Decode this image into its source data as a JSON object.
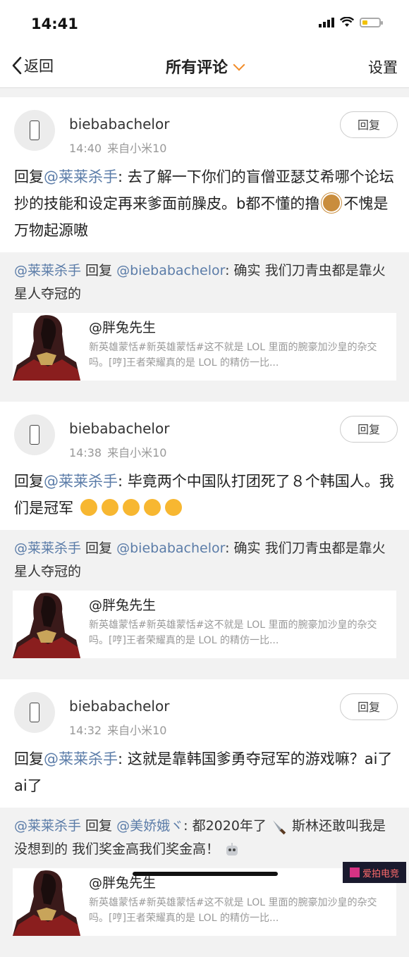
{
  "status_bar": {
    "time": "14:41"
  },
  "nav": {
    "back_label": "返回",
    "title": "所有评论",
    "settings_label": "设置"
  },
  "cards": [
    {
      "username": "biebabachelor",
      "time": "14:40",
      "source": "来自小米10",
      "reply_button": "回复",
      "comment_prefix": "回复",
      "comment_mention": "@莱莱杀手",
      "comment_text": ": 去了解一下你们的盲僧亚瑟艾希哪个论坛抄的技能和设定再来爹面前臊皮。b都不懂的撸",
      "comment_tail": "不愧是万物起源嗷",
      "quote_mention": "@莱莱杀手",
      "quote_reply": " 回复 ",
      "quote_target": "@biebabachelor",
      "quote_text": ": 确实 我们刀青虫都是靠火星人夺冠的",
      "embed_title": "@胖兔先生",
      "embed_desc": "新英雄蒙恬#新英雄蒙恬#这不就是 LOL 里面的腕豪加沙皇的杂交吗。[哼]王者荣耀真的是 LOL 的精仿一比..."
    },
    {
      "username": "biebabachelor",
      "time": "14:38",
      "source": "来自小米10",
      "reply_button": "回复",
      "comment_prefix": "回复",
      "comment_mention": "@莱莱杀手",
      "comment_text": ": 毕竟两个中国队打团死了８个韩国人。我们是冠军",
      "comment_tail": "",
      "quote_mention": "@莱莱杀手",
      "quote_reply": " 回复 ",
      "quote_target": "@biebabachelor",
      "quote_text": ": 确实 我们刀青虫都是靠火星人夺冠的",
      "embed_title": "@胖兔先生",
      "embed_desc": "新英雄蒙恬#新英雄蒙恬#这不就是 LOL 里面的腕豪加沙皇的杂交吗。[哼]王者荣耀真的是 LOL 的精仿一比..."
    },
    {
      "username": "biebabachelor",
      "time": "14:32",
      "source": "来自小米10",
      "reply_button": "回复",
      "comment_prefix": "回复",
      "comment_mention": "@莱莱杀手",
      "comment_text": ": 这就是靠韩国爹勇夺冠军的游戏嘛？ai了ai了",
      "comment_tail": "",
      "quote_mention": "@莱莱杀手",
      "quote_reply": " 回复 ",
      "quote_target": "@美娇娥ヾ",
      "quote_text": ": 都2020年了",
      "quote_text2": "斯林还敢叫我是没想到的 我们奖金高我们奖金高！",
      "embed_title": "@胖兔先生",
      "embed_desc": "新英雄蒙恬#新英雄蒙恬#这不就是 LOL 里面的腕豪加沙皇的杂交吗。[哼]王者荣耀真的是 LOL 的精仿一比..."
    }
  ],
  "watermark": {
    "text": "爱拍电竞"
  }
}
